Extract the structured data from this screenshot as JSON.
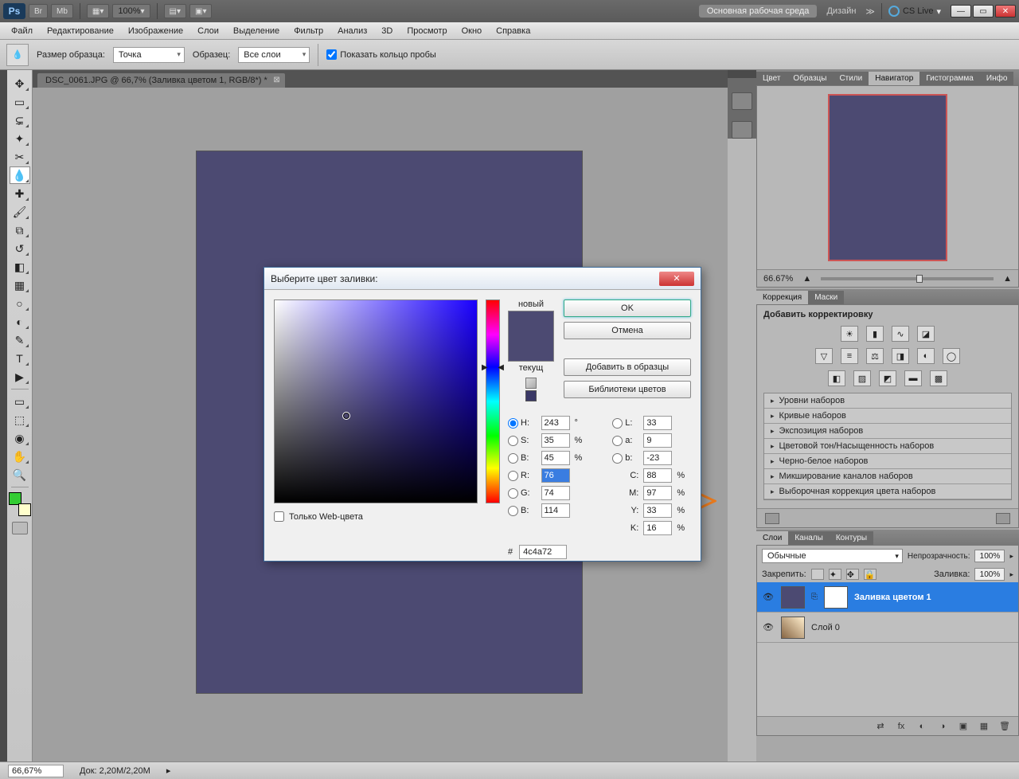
{
  "titlebar": {
    "zoom": "100%",
    "workspace": "Основная рабочая среда",
    "design": "Дизайн",
    "cslive": "CS Live"
  },
  "menu": [
    "Файл",
    "Редактирование",
    "Изображение",
    "Слои",
    "Выделение",
    "Фильтр",
    "Анализ",
    "3D",
    "Просмотр",
    "Окно",
    "Справка"
  ],
  "options": {
    "sample_label": "Размер образца:",
    "sample_value": "Точка",
    "sample2_label": "Образец:",
    "sample2_value": "Все слои",
    "show_ring": "Показать кольцо пробы"
  },
  "document": {
    "tab": "DSC_0061.JPG @ 66,7% (Заливка цветом 1, RGB/8*) *"
  },
  "navigator": {
    "tabs": [
      "Цвет",
      "Образцы",
      "Стили",
      "Навигатор",
      "Гистограмма",
      "Инфо"
    ],
    "zoom": "66.67%"
  },
  "adjust": {
    "tabs": [
      "Коррекция",
      "Маски"
    ],
    "title": "Добавить корректировку",
    "presets": [
      "Уровни наборов",
      "Кривые наборов",
      "Экспозиция наборов",
      "Цветовой тон/Насыщенность наборов",
      "Черно-белое наборов",
      "Микширование каналов наборов",
      "Выборочная коррекция цвета наборов"
    ]
  },
  "layers": {
    "tabs": [
      "Слои",
      "Каналы",
      "Контуры"
    ],
    "blend": "Обычные",
    "opacity_label": "Непрозрачность:",
    "opacity": "100%",
    "lock_label": "Закрепить:",
    "fill_label": "Заливка:",
    "fill": "100%",
    "items": [
      {
        "name": "Заливка цветом 1",
        "selected": true
      },
      {
        "name": "Слой 0",
        "selected": false
      }
    ]
  },
  "picker": {
    "title": "Выберите цвет заливки:",
    "new": "новый",
    "current": "текущ",
    "ok": "OK",
    "cancel": "Отмена",
    "add_swatch": "Добавить в образцы",
    "libraries": "Библиотеки цветов",
    "webonly": "Только Web-цвета",
    "H": "243",
    "S": "35",
    "B": "45",
    "R": "76",
    "G": "74",
    "Bb": "114",
    "L": "33",
    "a": "9",
    "b": "-23",
    "C": "88",
    "M": "97",
    "Y": "33",
    "K": "16",
    "hex": "4c4a72"
  },
  "status": {
    "zoom": "66,67%",
    "doc": "Док: 2,20М/2,20М"
  }
}
